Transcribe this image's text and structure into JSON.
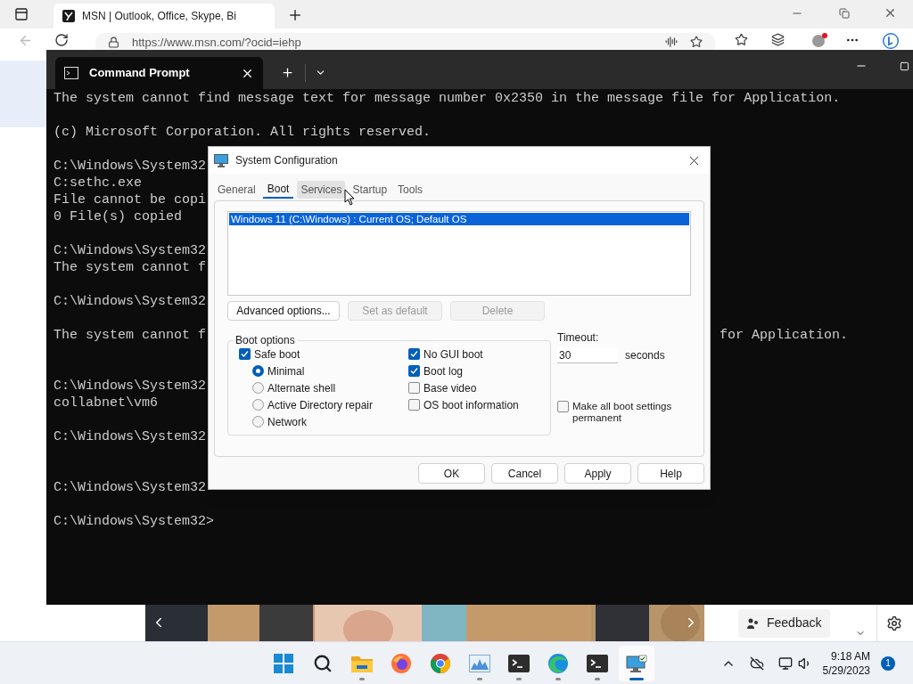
{
  "browser": {
    "tab_title": "MSN | Outlook, Office, Skype, Bi",
    "url": "https://www.msn.com/?ocid=iehp",
    "feedback": "Feedback"
  },
  "terminal": {
    "tab_title": "Command Prompt",
    "lines": [
      {
        "kind": "text",
        "text": "The system cannot find message text for message number 0x2350 in the message file for Application."
      },
      {
        "kind": "blank"
      },
      {
        "kind": "text",
        "text": "(c) Microsoft Corporation. All rights reserved."
      },
      {
        "kind": "blank"
      },
      {
        "kind": "text",
        "text": "C:\\Windows\\System32"
      },
      {
        "kind": "text",
        "text": "C:sethc.exe"
      },
      {
        "kind": "text",
        "text": "File cannot be copi"
      },
      {
        "kind": "text",
        "text": "0 File(s) copied"
      },
      {
        "kind": "blank"
      },
      {
        "kind": "text",
        "text": "C:\\Windows\\System32"
      },
      {
        "kind": "text",
        "text": "The system cannot f"
      },
      {
        "kind": "blank"
      },
      {
        "kind": "text",
        "text": "C:\\Windows\\System32"
      },
      {
        "kind": "blank"
      },
      {
        "kind": "text",
        "text": "The system cannot f",
        "right": "for Application."
      },
      {
        "kind": "blank"
      },
      {
        "kind": "blank"
      },
      {
        "kind": "text",
        "text": "C:\\Windows\\System32"
      },
      {
        "kind": "text",
        "text": "collabnet\\vm6"
      },
      {
        "kind": "blank"
      },
      {
        "kind": "text",
        "text": "C:\\Windows\\System32"
      },
      {
        "kind": "blank"
      },
      {
        "kind": "blank"
      },
      {
        "kind": "text",
        "text": "C:\\Windows\\System32"
      },
      {
        "kind": "blank"
      },
      {
        "kind": "text",
        "text": "C:\\Windows\\System32>"
      }
    ]
  },
  "dialog": {
    "title": "System Configuration",
    "tabs": [
      {
        "label": "General",
        "selected": false,
        "hovered": false
      },
      {
        "label": "Boot",
        "selected": true,
        "hovered": false
      },
      {
        "label": "Services",
        "selected": false,
        "hovered": true
      },
      {
        "label": "Startup",
        "selected": false,
        "hovered": false
      },
      {
        "label": "Tools",
        "selected": false,
        "hovered": false
      }
    ],
    "boot_entries": [
      {
        "text": "Windows 11 (C:\\Windows) : Current OS; Default OS",
        "selected": true
      }
    ],
    "entry_buttons": [
      {
        "label": "Advanced options...",
        "disabled": false
      },
      {
        "label": "Set as default",
        "disabled": true
      },
      {
        "label": "Delete",
        "disabled": true
      }
    ],
    "boot_options": {
      "title": "Boot options",
      "safe_boot": {
        "label": "Safe boot",
        "checked": true,
        "children": [
          {
            "label": "Minimal",
            "selected": true
          },
          {
            "label": "Alternate shell",
            "selected": false
          },
          {
            "label": "Active Directory repair",
            "selected": false
          },
          {
            "label": "Network",
            "selected": false
          }
        ]
      },
      "flags": [
        {
          "label": "No GUI boot",
          "checked": true
        },
        {
          "label": "Boot log",
          "checked": true
        },
        {
          "label": "Base video",
          "checked": false
        },
        {
          "label": "OS boot information",
          "checked": false
        }
      ]
    },
    "timeout": {
      "label": "Timeout:",
      "value": "30",
      "unit": "seconds"
    },
    "permanent": {
      "label": "Make all boot settings permanent",
      "checked": false
    },
    "buttons": [
      "OK",
      "Cancel",
      "Apply",
      "Help"
    ]
  },
  "taskbar": {
    "apps": [
      {
        "kind": "start"
      },
      {
        "kind": "search"
      },
      {
        "kind": "explorer",
        "running": true,
        "active": false
      },
      {
        "kind": "firefox",
        "running": false,
        "active": false
      },
      {
        "kind": "chrome",
        "running": false,
        "active": false
      },
      {
        "kind": "monitor",
        "running": true,
        "active": false
      },
      {
        "kind": "terminal",
        "running": true,
        "active": false
      },
      {
        "kind": "edge",
        "running": true,
        "active": false
      },
      {
        "kind": "terminal",
        "running": true,
        "active": false
      },
      {
        "kind": "msconfig",
        "running": true,
        "active": true
      }
    ],
    "clock": {
      "time": "9:18 AM",
      "date": "5/29/2023"
    },
    "notifications": "1"
  }
}
